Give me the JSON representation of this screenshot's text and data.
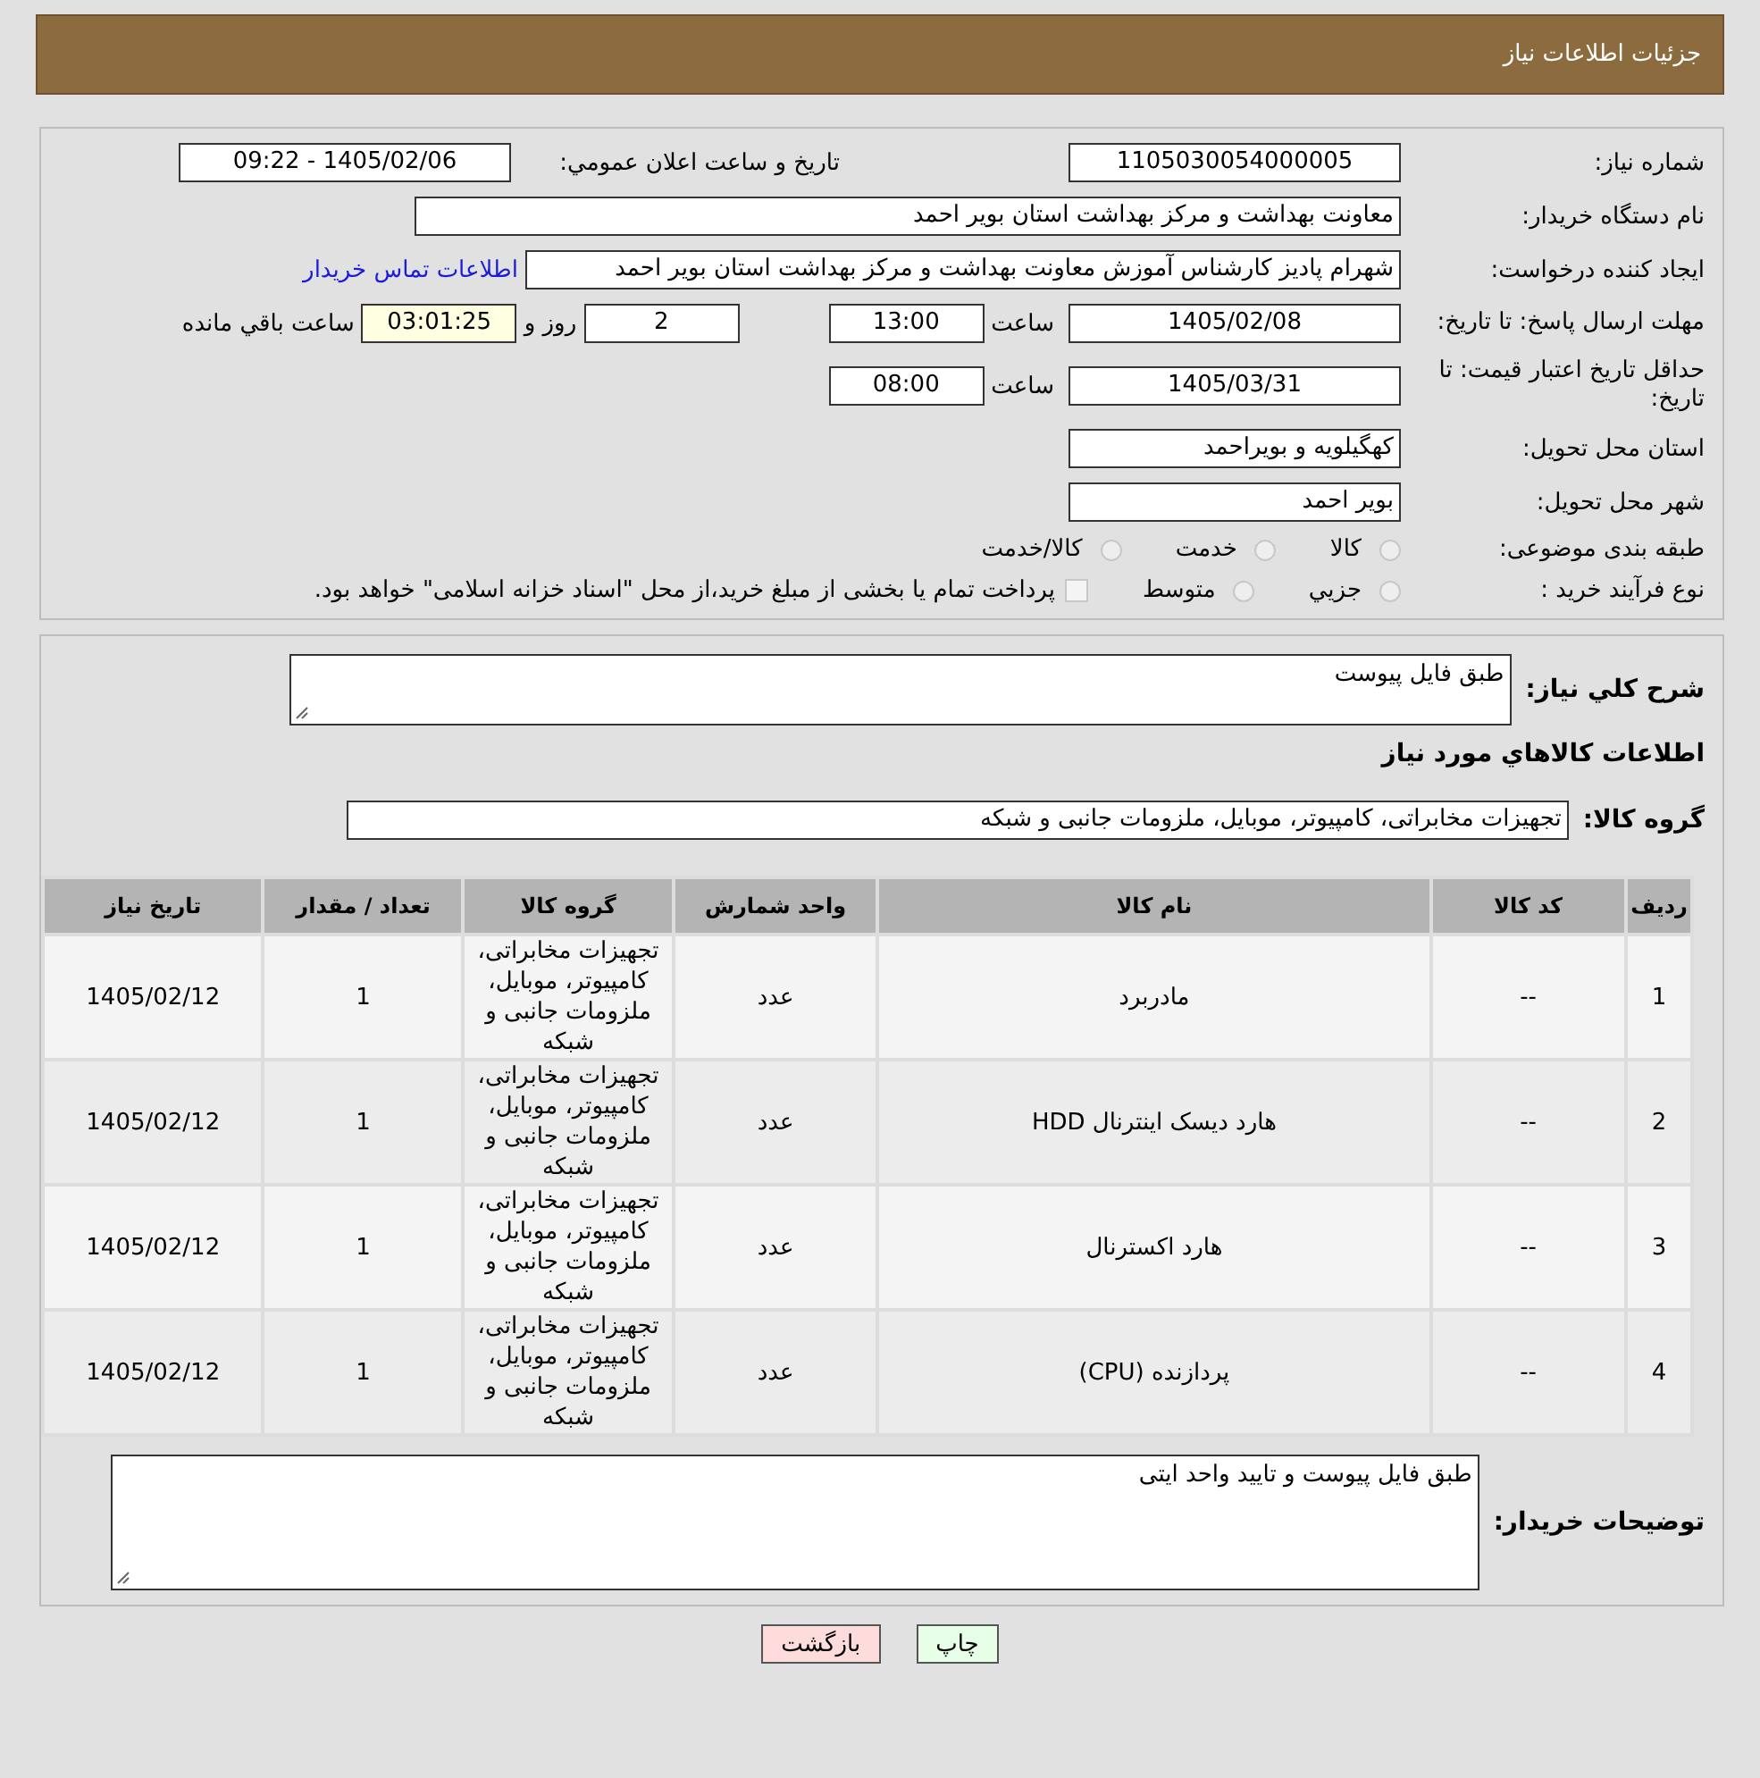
{
  "header": {
    "title": "جزئیات اطلاعات نیاز"
  },
  "details": {
    "need_number": {
      "label": "شماره نیاز:",
      "value": "1105030054000005"
    },
    "announce": {
      "label": "تاريخ و ساعت اعلان عمومي:",
      "value": "1405/02/06 - 09:22"
    },
    "buyer": {
      "label": "نام دستگاه خريدار:",
      "value": "معاونت بهداشت و مرکز بهداشت استان بویر احمد"
    },
    "requester": {
      "label": "ايجاد کننده درخواست:",
      "value": "شهرام پادیز کارشناس آموزش معاونت بهداشت و مرکز بهداشت استان بویر احمد",
      "link": "اطلاعات تماس خريدار"
    },
    "deadline": {
      "label": "مهلت ارسال پاسخ: تا تاریخ:",
      "date": "1405/02/08",
      "time_label": "ساعت",
      "time": "13:00",
      "days": "2",
      "days_label": "روز و",
      "remaining": "03:01:25",
      "remaining_label": "ساعت باقي مانده"
    },
    "validity": {
      "label": "حداقل تاریخ اعتبار قیمت: تا تاریخ:",
      "date": "1405/03/31",
      "time_label": "ساعت",
      "time": "08:00"
    },
    "province": {
      "label": "استان محل تحویل:",
      "value": "کهگیلویه و بویراحمد"
    },
    "city": {
      "label": "شهر محل تحویل:",
      "value": "بویر احمد"
    },
    "category": {
      "label": "طبقه بندی موضوعی:",
      "options": [
        {
          "label": "کالا",
          "selected": false
        },
        {
          "label": "خدمت",
          "selected": false
        },
        {
          "label": "کالا/خدمت",
          "selected": false
        }
      ]
    },
    "purchase_type": {
      "label": "نوع فرآیند خرید :",
      "options": [
        {
          "label": "جزيي",
          "selected": false
        },
        {
          "label": "متوسط",
          "selected": false
        }
      ],
      "note": {
        "checked": false,
        "text": "پرداخت تمام یا بخشی از مبلغ خرید،از محل \"اسناد خزانه اسلامی\" خواهد بود."
      }
    }
  },
  "goods": {
    "description": {
      "label": "شرح کلي نیاز:",
      "value": "طبق فایل پیوست"
    },
    "section_title": "اطلاعات کالاهاي مورد نیاز",
    "group": {
      "label": "گروه کالا:",
      "value": "تجهیزات مخابراتی، کامپیوتر، موبایل، ملزومات جانبی و شبکه"
    },
    "table": {
      "columns": [
        "ردیف",
        "کد کالا",
        "نام کالا",
        "واحد شمارش",
        "گروه کالا",
        "تعداد / مقدار",
        "تاریخ نیاز"
      ],
      "rows": [
        [
          "1",
          "--",
          "مادربرد",
          "عدد",
          "تجهیزات مخابراتی، کامپیوتر، موبایل، ملزومات جانبی و شبکه",
          "1",
          "1405/02/12"
        ],
        [
          "2",
          "--",
          "هارد دیسک اینترنال HDD",
          "عدد",
          "تجهیزات مخابراتی، کامپیوتر، موبایل، ملزومات جانبی و شبکه",
          "1",
          "1405/02/12"
        ],
        [
          "3",
          "--",
          "هارد اکسترنال",
          "عدد",
          "تجهیزات مخابراتی، کامپیوتر، موبایل، ملزومات جانبی و شبکه",
          "1",
          "1405/02/12"
        ],
        [
          "4",
          "--",
          "پردازنده (CPU)",
          "عدد",
          "تجهیزات مخابراتی، کامپیوتر، موبایل، ملزومات جانبی و شبکه",
          "1",
          "1405/02/12"
        ]
      ]
    },
    "buyer_notes": {
      "label": "توضیحات خریدار:",
      "value": "طبق فایل  پیوست  و تایید واحد ایتی"
    }
  },
  "buttons": [
    {
      "kind": "print",
      "label": "چاپ"
    },
    {
      "kind": "back",
      "label": "بازگشت"
    }
  ]
}
